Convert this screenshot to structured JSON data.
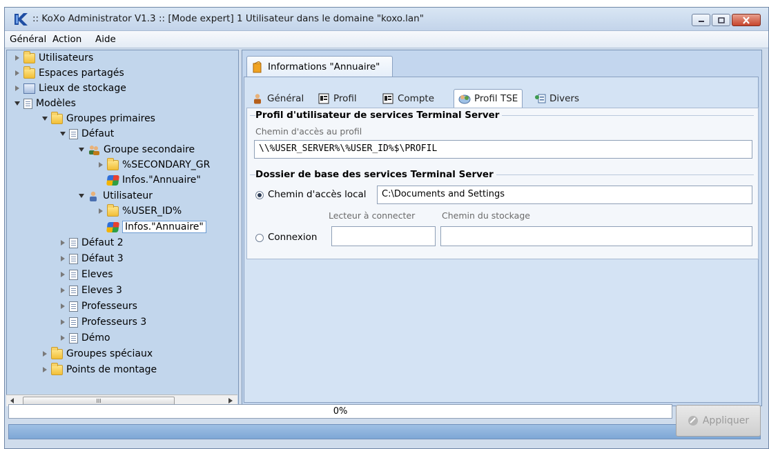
{
  "window": {
    "title": ":: KoXo Administrator V1.3 :: [Mode expert] 1 Utilisateur dans le domaine \"koxo.lan\""
  },
  "menu": {
    "items": [
      "Général",
      "Action",
      "Aide"
    ]
  },
  "tree": {
    "items": [
      {
        "label": "Utilisateurs"
      },
      {
        "label": "Espaces partagés"
      },
      {
        "label": "Lieux de stockage"
      },
      {
        "label": "Modèles"
      },
      {
        "label": "Groupes primaires"
      },
      {
        "label": "Défaut"
      },
      {
        "label": "Groupe secondaire"
      },
      {
        "label": "%SECONDARY_GR"
      },
      {
        "label": "Infos.\"Annuaire\""
      },
      {
        "label": "Utilisateur"
      },
      {
        "label": "%USER_ID%"
      },
      {
        "label": "Infos.\"Annuaire\""
      },
      {
        "label": "Défaut 2"
      },
      {
        "label": "Défaut 3"
      },
      {
        "label": "Eleves"
      },
      {
        "label": "Eleves 3"
      },
      {
        "label": "Professeurs"
      },
      {
        "label": "Professeurs 3"
      },
      {
        "label": "Démo"
      },
      {
        "label": "Groupes spéciaux"
      },
      {
        "label": "Points de montage"
      }
    ],
    "scrollbar_thumb": "III"
  },
  "outer_tab": {
    "label": "Informations \"Annuaire\""
  },
  "tabs": [
    {
      "label": "Général"
    },
    {
      "label": "Profil"
    },
    {
      "label": "Compte"
    },
    {
      "label": "Profil TSE"
    },
    {
      "label": "Divers"
    }
  ],
  "profile_group": {
    "title": "Profil d'utilisateur de services Terminal Server",
    "path_label": "Chemin d'accès au profil",
    "path_value": "\\\\%USER_SERVER%\\%USER_ID%$\\PROFIL"
  },
  "home_group": {
    "title": "Dossier de base des services Terminal Server",
    "local_label": "Chemin d'accès local",
    "local_value": "C:\\Documents and Settings",
    "connect_label": "Connexion",
    "drive_label": "Lecteur à connecter",
    "storage_label": "Chemin du stockage",
    "drive_value": "",
    "storage_value": ""
  },
  "progress": {
    "text": "0%",
    "value": 0
  },
  "apply_button": {
    "label": "Appliquer"
  }
}
